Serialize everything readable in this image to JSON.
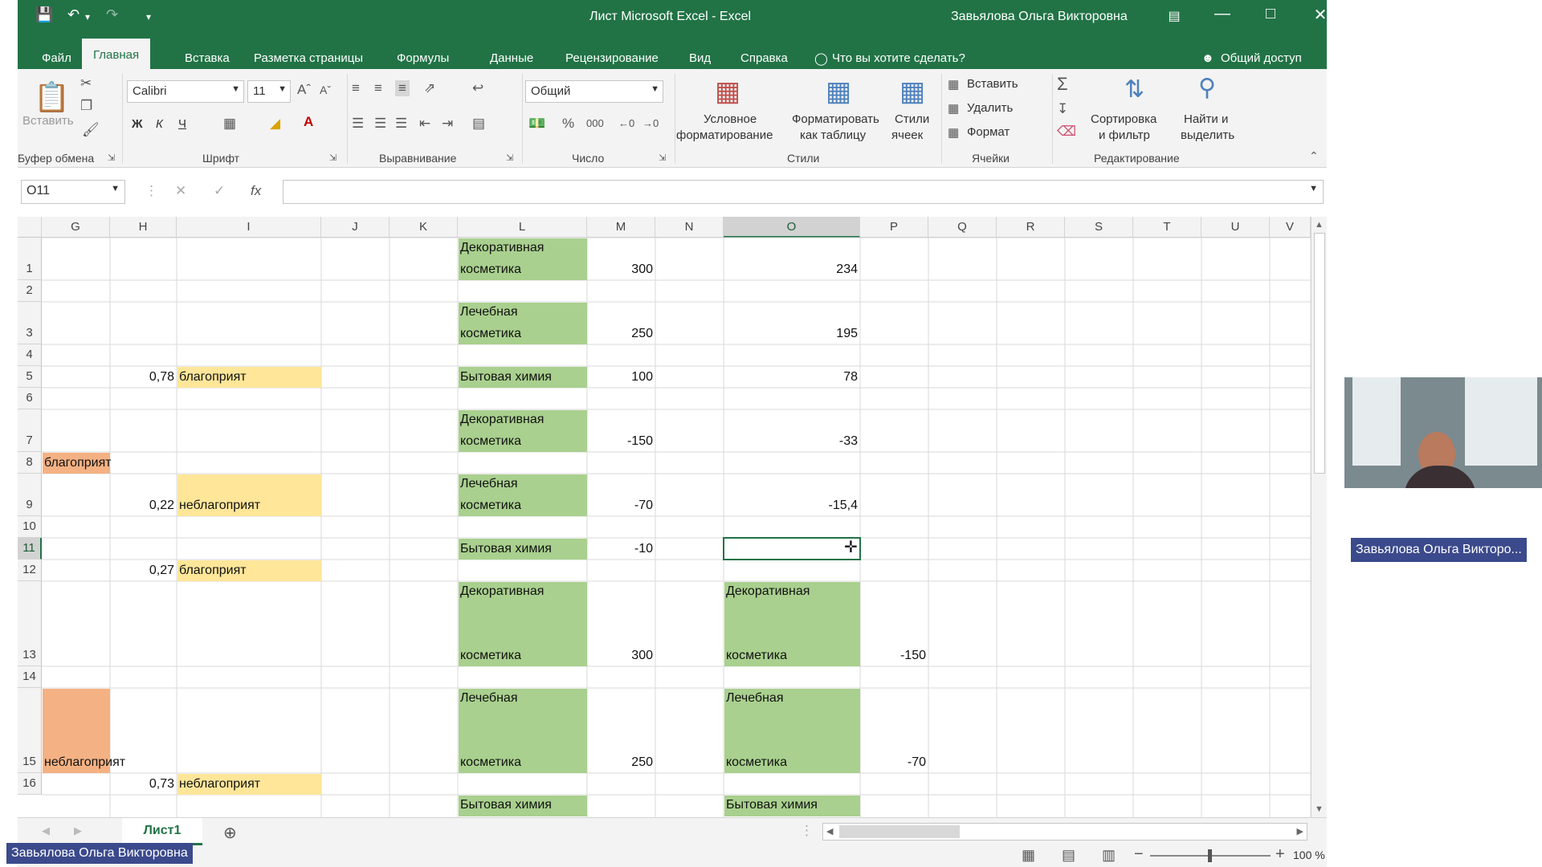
{
  "window": {
    "title": "Лист Microsoft Excel  -  Excel",
    "user": "Завьялова Ольга Викторовна"
  },
  "menu": {
    "tabs": [
      "Файл",
      "Главная",
      "Вставка",
      "Разметка страницы",
      "Формулы",
      "Данные",
      "Рецензирование",
      "Вид",
      "Справка"
    ],
    "search": "Что вы хотите сделать?",
    "share": "Общий доступ"
  },
  "ribbon": {
    "paste_label": "Вставить",
    "font_name": "Calibri",
    "font_size": "11",
    "bold": "Ж",
    "italic": "К",
    "underline": "Ч",
    "number_format": "Общий",
    "cond_format_1": "Условное",
    "cond_format_2": "форматирование",
    "format_table_1": "Форматировать",
    "format_table_2": "как таблицу",
    "styles_1": "Стили",
    "styles_2": "ячеек",
    "insert": "Вставить",
    "delete": "Удалить",
    "format": "Формат",
    "sort_1": "Сортировка",
    "sort_2": "и фильтр",
    "find_1": "Найти и",
    "find_2": "выделить",
    "groups": [
      "Буфер обмена",
      "Шрифт",
      "Выравнивание",
      "Число",
      "Стили",
      "Ячейки",
      "Редактирование"
    ]
  },
  "formula_bar": {
    "name_box": "O11",
    "fx": "fx",
    "content": ""
  },
  "columns": [
    "G",
    "H",
    "I",
    "J",
    "K",
    "L",
    "M",
    "N",
    "O",
    "P",
    "Q",
    "R",
    "S",
    "T",
    "U",
    "V"
  ],
  "rows": [
    "1",
    "2",
    "3",
    "4",
    "5",
    "6",
    "7",
    "8",
    "9",
    "10",
    "11",
    "12",
    "13",
    "14",
    "15",
    "16"
  ],
  "cells": {
    "L1a": "Декоративная",
    "L1b": "косметика",
    "M1": "300",
    "O1": "234",
    "L3a": "Лечебная",
    "L3b": "косметика",
    "M3": "250",
    "O3": "195",
    "H5": "0,78",
    "I5": "благоприят",
    "L5": "Бытовая химия",
    "M5": "100",
    "O5": "78",
    "L7a": "Декоративная",
    "L7b": "косметика",
    "M7": "-150",
    "O7": "-33",
    "G8": "благоприят",
    "H9": "0,22",
    "I9": "неблагоприят",
    "L9a": "Лечебная",
    "L9b": "косметика",
    "M9": "-70",
    "O9": "-15,4",
    "L11": "Бытовая химия",
    "M11": "-10",
    "H12": "0,27",
    "I12": "благоприят",
    "L13a": "Декоративная",
    "L13b": "косметика",
    "M13": "300",
    "O13a": "Декоративная",
    "O13b": "косметика",
    "P13": "-150",
    "L15a": "Лечебная",
    "L15b": "косметика",
    "M15": "250",
    "O15a": "Лечебная",
    "O15b": "косметика",
    "P15": "-70",
    "G15": "неблагоприят",
    "H16": "0,73",
    "I16": "неблагоприят",
    "L17": "Бытовая химия",
    "O17": "Бытовая химия"
  },
  "sheet_tab": "Лист1",
  "zoom": "100 %",
  "participant": {
    "label": "Завьялова Ольга Викторо...",
    "bottom_label": "Завьялова Ольга Викторовна"
  },
  "colors": {
    "excel_green": "#217346",
    "green_fill": "#a9d08e",
    "yellow_fill": "#ffe699",
    "orange_fill": "#f4b183"
  }
}
